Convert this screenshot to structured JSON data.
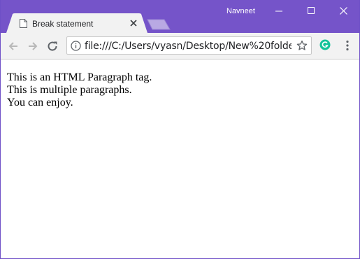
{
  "window": {
    "profile_name": "Navneet"
  },
  "tab": {
    "title": "Break statement"
  },
  "toolbar": {
    "url": "file:///C:/Users/vyasn/Desktop/New%20folder..."
  },
  "page": {
    "lines": [
      "This is an HTML Paragraph tag.",
      "This is multiple paragraphs.",
      "You can enjoy."
    ]
  },
  "colors": {
    "titlebar": "#7554c9",
    "extension_green": "#15c39a"
  },
  "icons": [
    "document-icon",
    "close-icon",
    "back-icon",
    "forward-icon",
    "reload-icon",
    "info-icon",
    "star-icon",
    "grammarly-icon",
    "menu-icon",
    "minimize-icon",
    "maximize-icon"
  ]
}
